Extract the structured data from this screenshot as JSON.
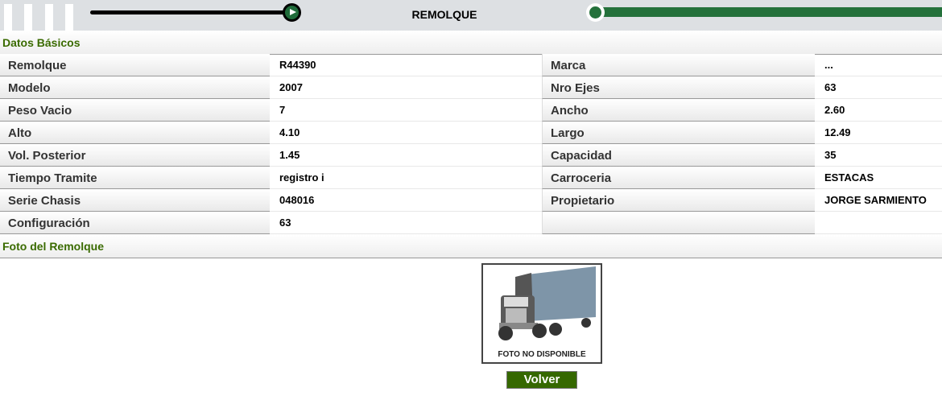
{
  "header": {
    "title": "REMOLQUE"
  },
  "sections": {
    "basic": "Datos Básicos",
    "photo": "Foto del Remolque"
  },
  "rows": [
    {
      "l1": "Remolque",
      "v1": "R44390",
      "l2": "Marca",
      "v2": "..."
    },
    {
      "l1": "Modelo",
      "v1": "2007",
      "l2": "Nro Ejes",
      "v2": "63"
    },
    {
      "l1": "Peso Vacio",
      "v1": "7",
      "l2": "Ancho",
      "v2": "2.60"
    },
    {
      "l1": "Alto",
      "v1": "4.10",
      "l2": "Largo",
      "v2": "12.49"
    },
    {
      "l1": "Vol. Posterior",
      "v1": "1.45",
      "l2": "Capacidad",
      "v2": "35"
    },
    {
      "l1": "Tiempo Tramite",
      "v1": "registro i",
      "l2": "Carroceria",
      "v2": "ESTACAS"
    },
    {
      "l1": "Serie Chasis",
      "v1": "048016",
      "l2": "Propietario",
      "v2": "JORGE SARMIENTO"
    },
    {
      "l1": "Configuración",
      "v1": "63",
      "l2": "",
      "v2": ""
    }
  ],
  "photo": {
    "caption": "FOTO NO DISPONIBLE"
  },
  "buttons": {
    "back": "Volver"
  }
}
